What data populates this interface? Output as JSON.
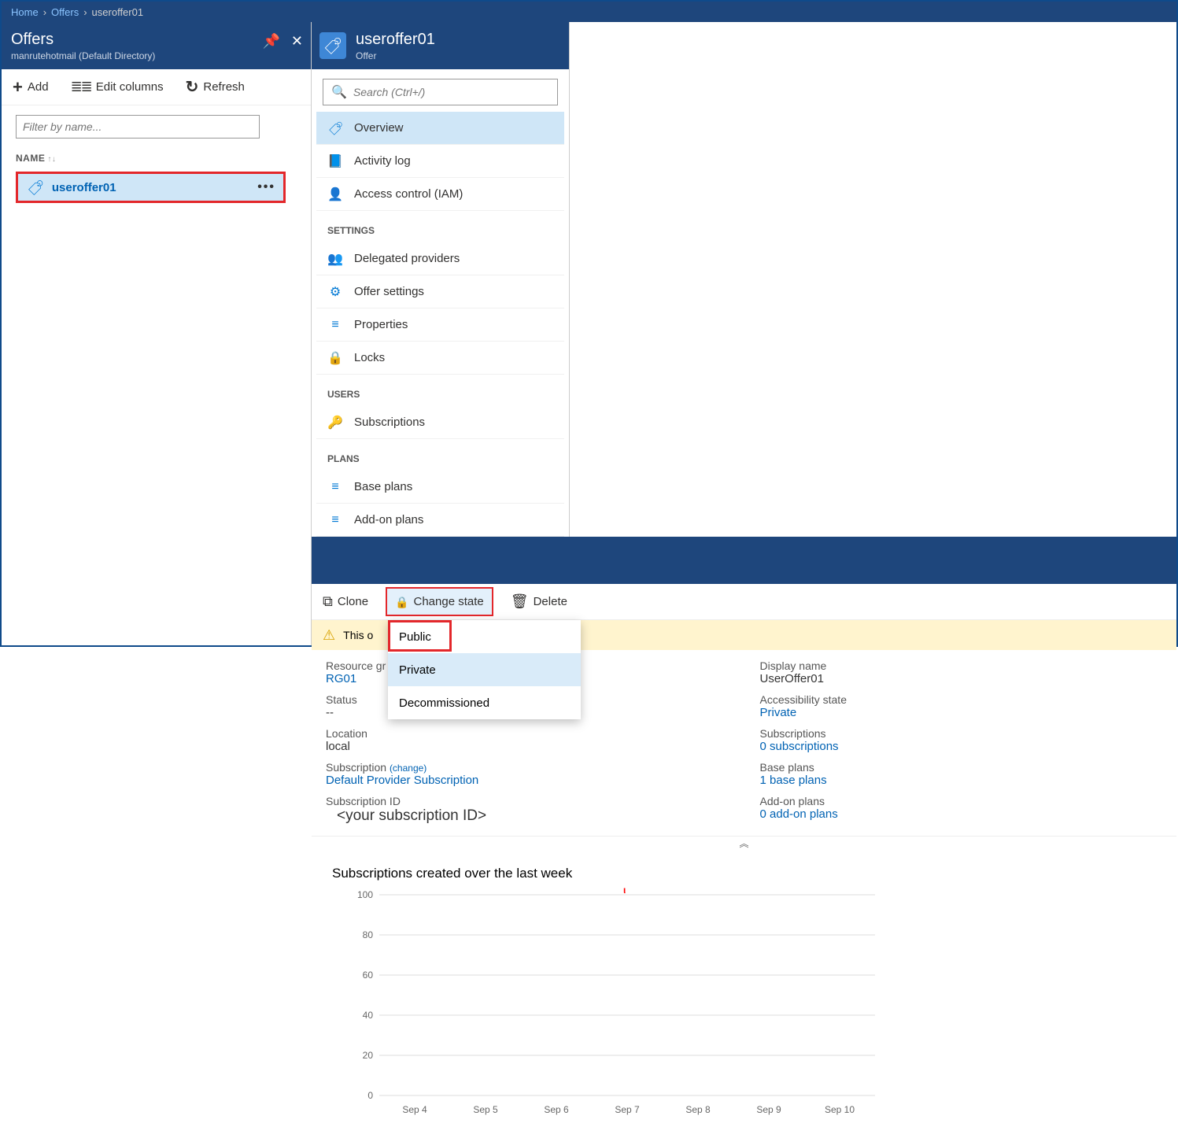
{
  "breadcrumb": {
    "home": "Home",
    "offers": "Offers",
    "current": "useroffer01"
  },
  "offers_panel": {
    "title": "Offers",
    "subtitle": "manrutehotmail (Default Directory)",
    "toolbar": {
      "add": "Add",
      "edit_columns": "Edit columns",
      "refresh": "Refresh"
    },
    "filter_placeholder": "Filter by name...",
    "column_header": "NAME",
    "row": {
      "name": "useroffer01"
    }
  },
  "detail_panel": {
    "title": "useroffer01",
    "subtitle": "Offer",
    "search_placeholder": "Search (Ctrl+/)",
    "nav": {
      "overview": "Overview",
      "activity_log": "Activity log",
      "access_control": "Access control (IAM)",
      "section_settings": "SETTINGS",
      "delegated": "Delegated providers",
      "offer_settings": "Offer settings",
      "properties": "Properties",
      "locks": "Locks",
      "section_users": "USERS",
      "subscriptions": "Subscriptions",
      "section_plans": "PLANS",
      "base_plans": "Base plans",
      "addon_plans": "Add-on plans"
    }
  },
  "main": {
    "toolbar": {
      "clone": "Clone",
      "change_state": "Change state",
      "delete": "Delete"
    },
    "dropdown": {
      "public": "Public",
      "private": "Private",
      "decommissioned": "Decommissioned"
    },
    "warning_prefix": "This o",
    "props": {
      "resource_group_label": "Resource gr",
      "resource_group_value": "RG01",
      "status_label": "Status",
      "status_value": "--",
      "location_label": "Location",
      "location_value": "local",
      "subscription_label": "Subscription",
      "change": "(change)",
      "subscription_value": "Default Provider Subscription",
      "subscription_id_label": "Subscription ID",
      "subscription_id_value": "<your subscription ID>",
      "display_name_label": "Display name",
      "display_name_value": "UserOffer01",
      "accessibility_label": "Accessibility state",
      "accessibility_value": "Private",
      "subscriptions_label": "Subscriptions",
      "subscriptions_value": "0 subscriptions",
      "base_plans_label": "Base plans",
      "base_plans_value": "1 base plans",
      "addon_plans_label": "Add-on plans",
      "addon_plans_value": "0 add-on plans"
    },
    "collapse": "︽",
    "chart_title": "Subscriptions created over the last week"
  },
  "chart_data": {
    "type": "line",
    "title": "Subscriptions created over the last week",
    "xlabel": "",
    "ylabel": "",
    "ylim": [
      0,
      100
    ],
    "y_ticks": [
      0,
      20,
      40,
      60,
      80,
      100
    ],
    "categories": [
      "Sep 4",
      "Sep 5",
      "Sep 6",
      "Sep 7",
      "Sep 8",
      "Sep 9",
      "Sep 10"
    ],
    "values": []
  }
}
